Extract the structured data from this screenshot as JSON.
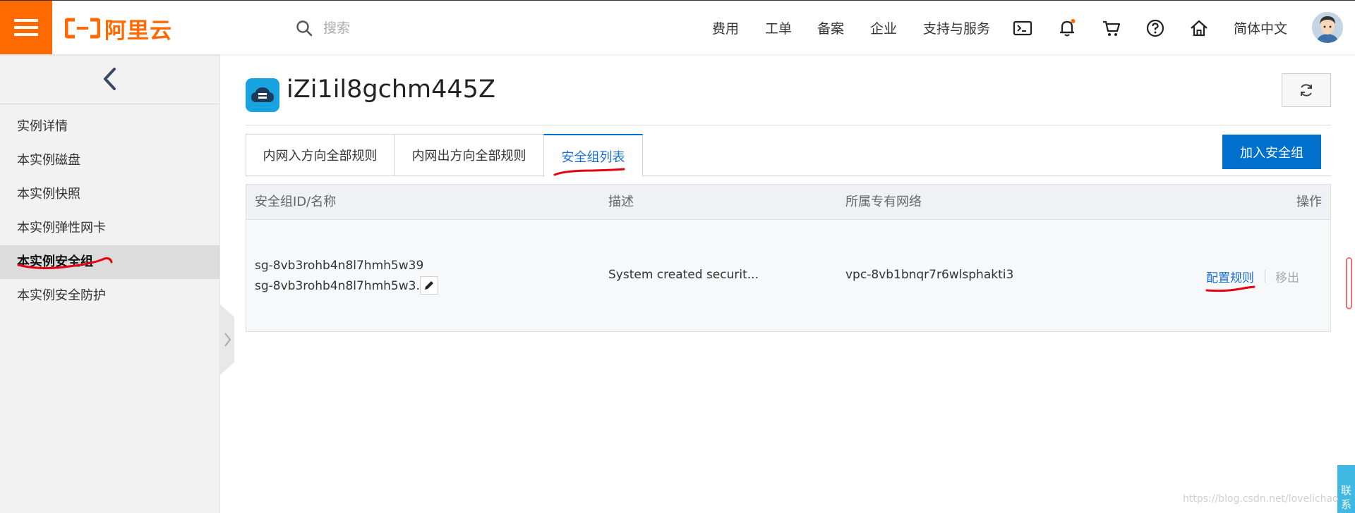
{
  "brand": {
    "name": "阿里云",
    "color": "#ff6a00"
  },
  "search": {
    "placeholder": "搜索"
  },
  "nav": {
    "items": [
      "费用",
      "工单",
      "备案",
      "企业",
      "支持与服务"
    ],
    "icons": [
      "terminal-icon",
      "bell-icon",
      "cart-icon",
      "help-icon",
      "home-icon"
    ],
    "language": "简体中文"
  },
  "sidebar": {
    "items": [
      "实例详情",
      "本实例磁盘",
      "本实例快照",
      "本实例弹性网卡",
      "本实例安全组",
      "本实例安全防护"
    ],
    "active_index": 4
  },
  "instance": {
    "title": "iZi1il8gchm445Z"
  },
  "tabs": [
    {
      "label": "内网入方向全部规则"
    },
    {
      "label": "内网出方向全部规则"
    },
    {
      "label": "安全组列表"
    }
  ],
  "active_tab": 2,
  "join_button": "加入安全组",
  "table": {
    "headers": [
      "安全组ID/名称",
      "描述",
      "所属专有网络",
      "操作"
    ],
    "rows": [
      {
        "id": "sg-8vb3rohb4n8l7hmh5w39",
        "name": "sg-8vb3rohb4n8l7hmh5w3...",
        "description": "System created securit...",
        "vpc": "vpc-8vb1bnqr7r6wlsphakti3",
        "actions": [
          "配置规则",
          "移出"
        ]
      }
    ]
  },
  "float_button": "联系",
  "watermark": "https://blog.csdn.net/lovelichao",
  "colors": {
    "accent": "#0070cc",
    "link": "#1a6fd0",
    "annotation": "#e60012"
  }
}
